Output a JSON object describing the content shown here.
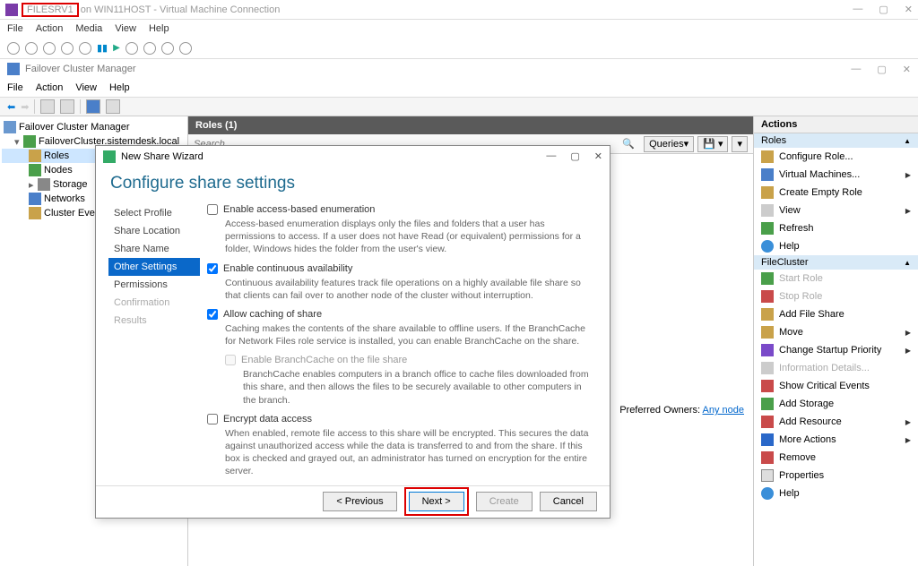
{
  "vm": {
    "highlight": "FILESRV1",
    "suffix": "on WIN11HOST - Virtual Machine Connection",
    "menu": [
      "File",
      "Action",
      "Media",
      "View",
      "Help"
    ]
  },
  "app": {
    "title": "Failover Cluster Manager",
    "menu": [
      "File",
      "Action",
      "View",
      "Help"
    ]
  },
  "tree": {
    "root": "Failover Cluster Manager",
    "cluster": "FailoverCluster.sistemdesk.local",
    "nodes": [
      "Roles",
      "Nodes",
      "Storage",
      "Networks",
      "Cluster Events"
    ]
  },
  "roles": {
    "header": "Roles (1)",
    "search_placeholder": "Search",
    "queries": "Queries",
    "preferred_label": "Preferred Owners:",
    "preferred_link": "Any node"
  },
  "wizard": {
    "title": "New Share Wizard",
    "heading": "Configure share settings",
    "nav": [
      "Select Profile",
      "Share Location",
      "Share Name",
      "Other Settings",
      "Permissions",
      "Confirmation",
      "Results"
    ],
    "opt1_label": "Enable access-based enumeration",
    "opt1_desc": "Access-based enumeration displays only the files and folders that a user has permissions to access. If a user does not have Read (or equivalent) permissions for a folder, Windows hides the folder from the user's view.",
    "opt2_label": "Enable continuous availability",
    "opt2_desc": "Continuous availability features track file operations on a highly available file share so that clients can fail over to another node of the cluster without interruption.",
    "opt3_label": "Allow caching of share",
    "opt3_desc": "Caching makes the contents of the share available to offline users. If the BranchCache for Network Files role service is installed, you can enable BranchCache on the share.",
    "opt3a_label": "Enable BranchCache on the file share",
    "opt3a_desc": "BranchCache enables computers in a branch office to cache files downloaded from this share, and then allows the files to be securely available to other computers in the branch.",
    "opt4_label": "Encrypt data access",
    "opt4_desc": "When enabled, remote file access to this share will be encrypted. This secures the data against unauthorized access while the data is transferred to and from the share. If this box is checked and grayed out, an administrator has turned on encryption for the entire server.",
    "btn_prev": "< Previous",
    "btn_next": "Next >",
    "btn_create": "Create",
    "btn_cancel": "Cancel"
  },
  "actions": {
    "header": "Actions",
    "section1": "Roles",
    "section2": "FileCluster",
    "s1": [
      {
        "label": "Configure Role...",
        "ic": "ic-cfg"
      },
      {
        "label": "Virtual Machines...",
        "ic": "ic-vm",
        "arrow": true
      },
      {
        "label": "Create Empty Role",
        "ic": "ic-role"
      },
      {
        "label": "View",
        "ic": "ic-view",
        "arrow": true
      },
      {
        "label": "Refresh",
        "ic": "ic-ref"
      },
      {
        "label": "Help",
        "ic": "ic-help"
      }
    ],
    "s2": [
      {
        "label": "Start Role",
        "ic": "ic-start",
        "dis": true
      },
      {
        "label": "Stop Role",
        "ic": "ic-stop",
        "dis": true
      },
      {
        "label": "Add File Share",
        "ic": "ic-share"
      },
      {
        "label": "Move",
        "ic": "ic-move",
        "arrow": true
      },
      {
        "label": "Change Startup Priority",
        "ic": "ic-pri",
        "arrow": true
      },
      {
        "label": "Information Details...",
        "ic": "ic-info",
        "dis": true
      },
      {
        "label": "Show Critical Events",
        "ic": "ic-crit"
      },
      {
        "label": "Add Storage",
        "ic": "ic-stor"
      },
      {
        "label": "Add Resource",
        "ic": "ic-res",
        "arrow": true
      },
      {
        "label": "More Actions",
        "ic": "ic-more",
        "arrow": true
      },
      {
        "label": "Remove",
        "ic": "ic-rem"
      },
      {
        "label": "Properties",
        "ic": "ic-prop"
      },
      {
        "label": "Help",
        "ic": "ic-help"
      }
    ]
  }
}
